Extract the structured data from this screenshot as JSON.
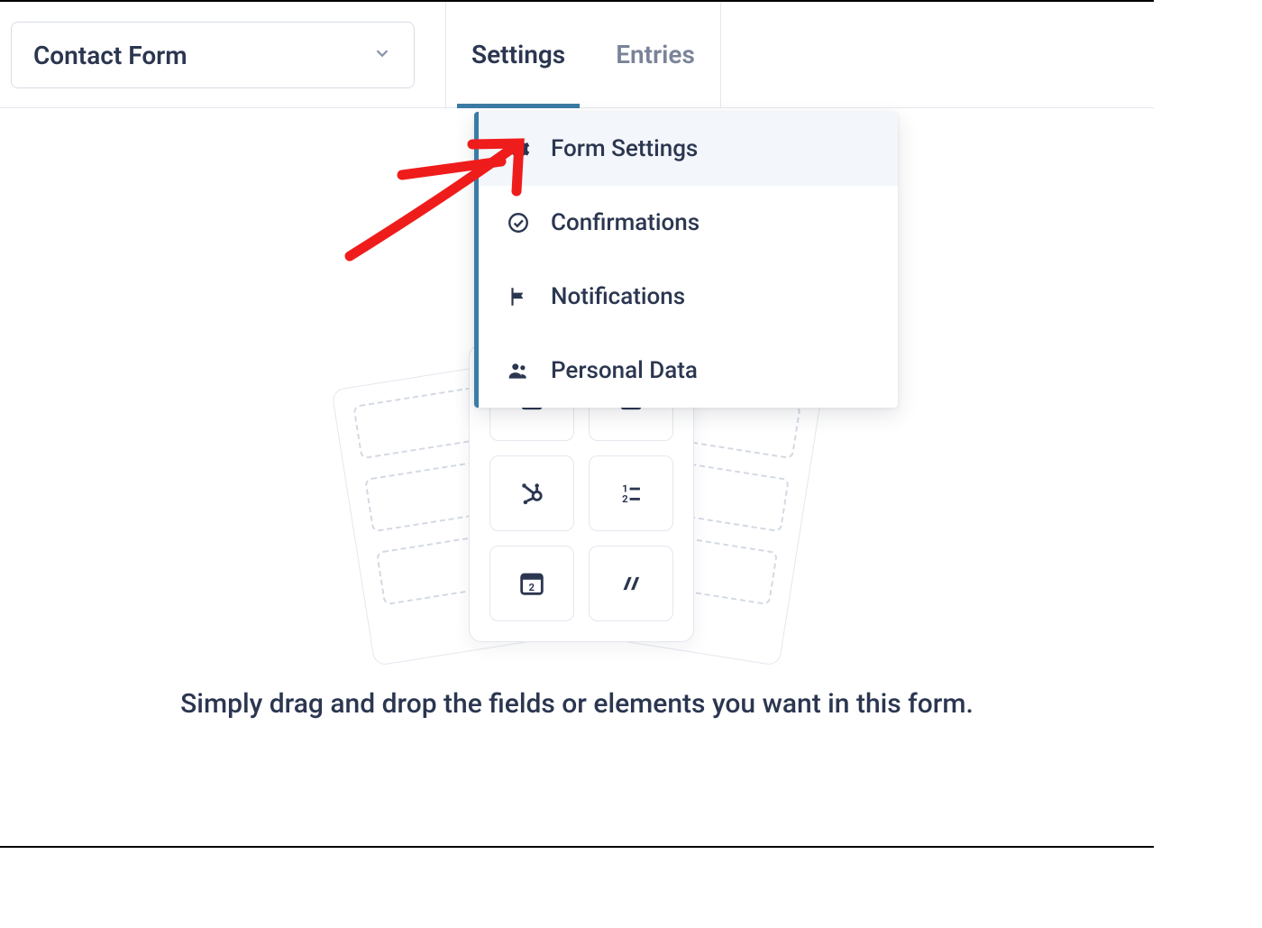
{
  "header": {
    "form_name": "Contact Form",
    "tabs": [
      {
        "label": "Settings",
        "active": true
      },
      {
        "label": "Entries",
        "active": false
      }
    ]
  },
  "settings_menu": {
    "items": [
      {
        "icon": "gear",
        "label": "Form Settings",
        "selected": true
      },
      {
        "icon": "check",
        "label": "Confirmations",
        "selected": false
      },
      {
        "icon": "flag",
        "label": "Notifications",
        "selected": false
      },
      {
        "icon": "people",
        "label": "Personal Data",
        "selected": false
      }
    ]
  },
  "canvas": {
    "instruction": "Simply drag and drop the fields or elements you want in this form.",
    "tile_icons": [
      "hubspot",
      "numbered-list",
      "calendar-date",
      "stripes"
    ]
  },
  "annotation": {
    "type": "hand-drawn-arrow",
    "color": "#ef1c1c",
    "target": "settings_menu.items.0"
  }
}
